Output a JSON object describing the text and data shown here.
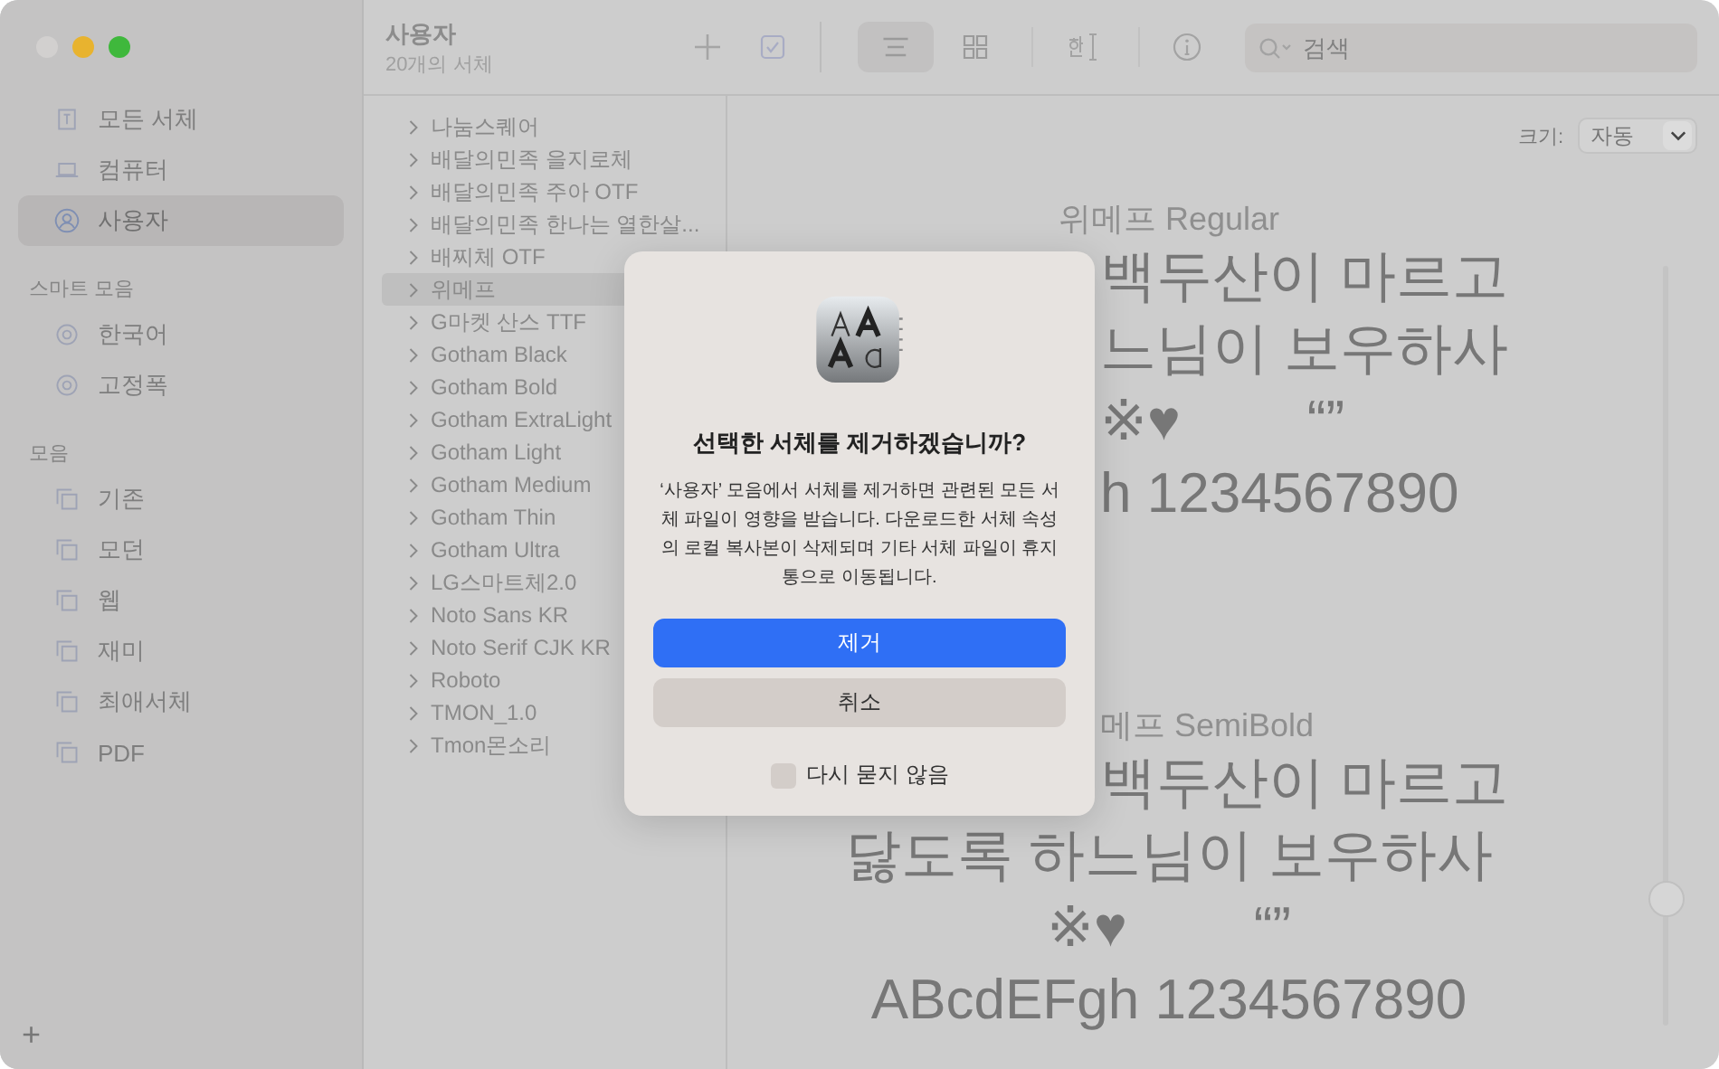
{
  "window": {
    "controls": [
      {
        "color": "#d2d0cf"
      },
      {
        "color": "#e8b32f"
      },
      {
        "color": "#3fb83c"
      }
    ]
  },
  "sidebar": {
    "sections": [
      {
        "items": [
          {
            "label": "모든 서체",
            "kind": "font",
            "selected": false
          },
          {
            "label": "컴퓨터",
            "kind": "laptop",
            "selected": false
          },
          {
            "label": "사용자",
            "kind": "person",
            "selected": true
          }
        ]
      },
      {
        "title": "스마트 모음",
        "items": [
          {
            "label": "한국어",
            "kind": "smart",
            "selected": false
          },
          {
            "label": "고정폭",
            "kind": "smart",
            "selected": false
          }
        ]
      },
      {
        "title": "모음",
        "items": [
          {
            "label": "기존",
            "kind": "collection",
            "selected": false
          },
          {
            "label": "모던",
            "kind": "collection",
            "selected": false
          },
          {
            "label": "웹",
            "kind": "collection",
            "selected": false
          },
          {
            "label": "재미",
            "kind": "collection",
            "selected": false
          },
          {
            "label": "최애서체",
            "kind": "collection",
            "selected": false
          },
          {
            "label": "PDF",
            "kind": "collection",
            "selected": false
          }
        ]
      }
    ],
    "add_button": "+"
  },
  "toolbar": {
    "title": "사용자",
    "subtitle": "20개의 서체",
    "view_buttons": [
      {
        "kind": "list",
        "selected": true
      },
      {
        "kind": "grid",
        "selected": false
      }
    ],
    "search": {
      "placeholder": "검색"
    }
  },
  "font_list": [
    {
      "name": "나눔스퀘어",
      "selected": false,
      "expanded": false
    },
    {
      "name": "배달의민족 을지로체",
      "selected": false,
      "expanded": false
    },
    {
      "name": "배달의민족 주아 OTF",
      "selected": false,
      "expanded": false
    },
    {
      "name": "배달의민족 한나는 열한살...",
      "selected": false,
      "expanded": false
    },
    {
      "name": "배찌체 OTF",
      "selected": false,
      "expanded": false
    },
    {
      "name": "위메프",
      "selected": true,
      "expanded": false
    },
    {
      "name": "G마켓 산스 TTF",
      "selected": false,
      "expanded": false
    },
    {
      "name": "Gotham Black",
      "selected": false,
      "expanded": false
    },
    {
      "name": "Gotham Bold",
      "selected": false,
      "expanded": false
    },
    {
      "name": "Gotham ExtraLight",
      "selected": false,
      "expanded": false
    },
    {
      "name": "Gotham Light",
      "selected": false,
      "expanded": false
    },
    {
      "name": "Gotham Medium",
      "selected": false,
      "expanded": false
    },
    {
      "name": "Gotham Thin",
      "selected": false,
      "expanded": false
    },
    {
      "name": "Gotham Ultra",
      "selected": false,
      "expanded": false
    },
    {
      "name": "LG스마트체2.0",
      "selected": false,
      "expanded": false
    },
    {
      "name": "Noto Sans KR",
      "selected": false,
      "expanded": false
    },
    {
      "name": "Noto Serif CJK KR",
      "selected": false,
      "expanded": false
    },
    {
      "name": "Roboto",
      "selected": false,
      "expanded": false
    },
    {
      "name": "TMON_1.0",
      "selected": false,
      "expanded": false
    },
    {
      "name": "Tmon몬소리",
      "selected": false,
      "expanded": false
    }
  ],
  "preview": {
    "size_label": "크기:",
    "size_value": "자동",
    "size_slider": {
      "level": 0.15
    },
    "samples": [
      {
        "lines": [
          {
            "kind": "caption",
            "texts": [
              "위메프 Regular"
            ]
          },
          {
            "kind": "sample",
            "clipped": true,
            "texts": [
              "백두산이 마르고"
            ]
          },
          {
            "kind": "sample",
            "clipped": true,
            "texts": [
              "느님이 보우하사"
            ]
          },
          {
            "kind": "sample",
            "clipped": true,
            "texts": [
              "※♥",
              "“”"
            ]
          },
          {
            "kind": "sample",
            "clipped": true,
            "texts": [
              "h 1234567890"
            ]
          }
        ]
      },
      {
        "lines": [
          {
            "kind": "caption",
            "clipped": true,
            "texts": [
              "메프 SemiBold"
            ]
          },
          {
            "kind": "sample",
            "clipped": true,
            "texts": [
              "백두산이 마르고"
            ]
          },
          {
            "kind": "sample",
            "clipped": false,
            "texts": [
              "닳도록 하느님이 보우하사"
            ]
          },
          {
            "kind": "sample",
            "clipped": false,
            "texts": [
              "※♥",
              "“”"
            ]
          },
          {
            "kind": "sample",
            "clipped": false,
            "texts": [
              "ABcdEFgh 1234567890"
            ]
          }
        ]
      }
    ]
  },
  "dialog": {
    "title": "선택한 서체를 제거하겠습니까?",
    "message": "‘사용자’ 모음에서 서체를 제거하면 관련된 모든 서체 파일이 영향을 받습니다. 다운로드한 서체 속성의 로컬 복사본이 삭제되며 기타 서체 파일이 휴지통으로 이동됩니다.",
    "buttons": [
      {
        "label": "제거",
        "kind": "primary"
      },
      {
        "label": "취소",
        "kind": "secondary"
      }
    ],
    "checkbox": {
      "label": "다시 묻지 않음",
      "checked": false
    }
  }
}
